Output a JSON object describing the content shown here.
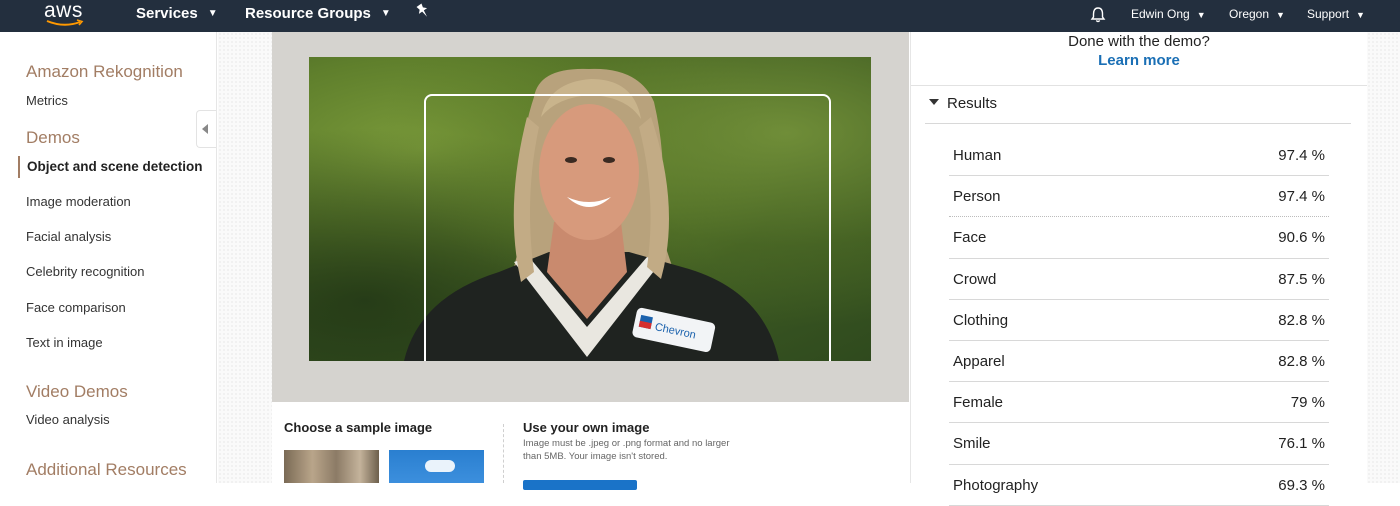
{
  "topnav": {
    "logo_text": "aws",
    "services": "Services",
    "resource_groups": "Resource Groups",
    "user": "Edwin Ong",
    "region": "Oregon",
    "support": "Support"
  },
  "sidebar": {
    "section_rekognition": "Amazon Rekognition",
    "metrics": "Metrics",
    "section_demos": "Demos",
    "items": [
      {
        "label": "Object and scene detection",
        "active": true
      },
      {
        "label": "Image moderation"
      },
      {
        "label": "Facial analysis"
      },
      {
        "label": "Celebrity recognition"
      },
      {
        "label": "Face comparison"
      },
      {
        "label": "Text in image"
      }
    ],
    "section_video": "Video Demos",
    "video_analysis": "Video analysis",
    "section_additional": "Additional Resources"
  },
  "samples": {
    "title": "Choose a sample image",
    "own_title": "Use your own image",
    "own_desc": "Image must be .jpeg or .png format and no larger than 5MB. Your image isn't stored."
  },
  "results": {
    "done_text": "Done with the demo?",
    "learn_more": "Learn more",
    "header": "Results",
    "rows": [
      {
        "label": "Human",
        "value": "97.4 %"
      },
      {
        "label": "Person",
        "value": "97.4 %"
      },
      {
        "label": "Face",
        "value": "90.6 %"
      },
      {
        "label": "Crowd",
        "value": "87.5 %"
      },
      {
        "label": "Clothing",
        "value": "82.8 %"
      },
      {
        "label": "Apparel",
        "value": "82.8 %"
      },
      {
        "label": "Female",
        "value": "79 %"
      },
      {
        "label": "Smile",
        "value": "76.1 %"
      },
      {
        "label": "Photography",
        "value": "69.3 %"
      }
    ]
  },
  "photo": {
    "badge_text": "Chevron"
  },
  "colors": {
    "nav_bg": "#232f3e",
    "section_heading": "#a27d64",
    "link_blue": "#1a6fb5"
  }
}
